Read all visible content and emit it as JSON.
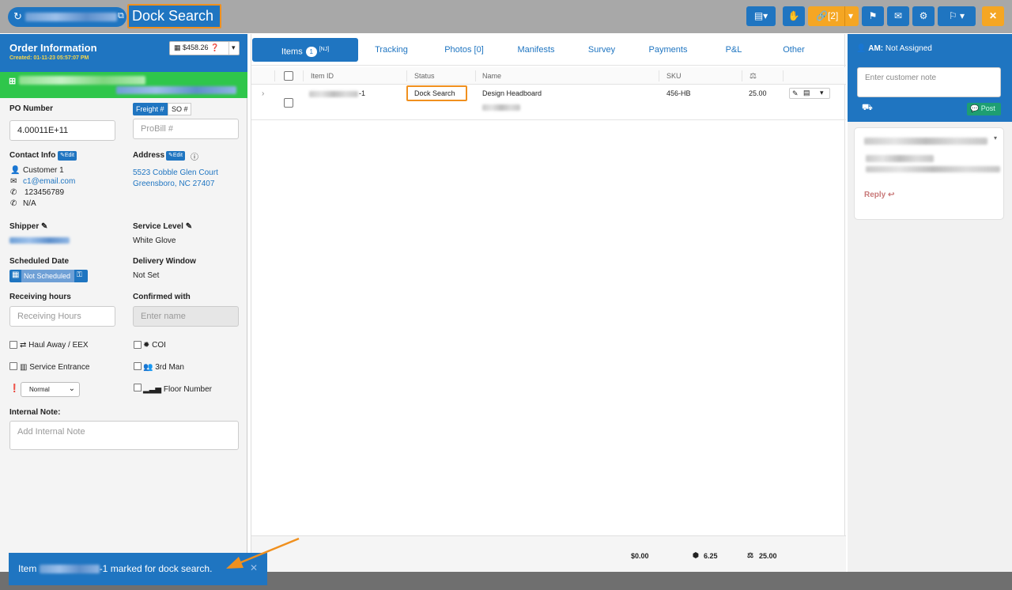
{
  "header": {
    "title": "Dock Search",
    "buttons": {
      "links_count": "[2]"
    }
  },
  "order_info": {
    "title": "Order Information",
    "created": "Created: 01-11-23 05:57:07 PM",
    "price": "$458.26",
    "po_label": "PO Number",
    "po_value": "4.00011E+11",
    "freight_tab": "Freight #",
    "so_tab": "SO #",
    "probill_placeholder": "ProBill #",
    "contact_label": "Contact Info",
    "edit_label": "Edit",
    "address_label": "Address",
    "contact_name": "Customer 1",
    "contact_email": "c1@email.com",
    "contact_phone": "123456789",
    "contact_phone2": "N/A",
    "address_line1": "5523 Cobble Glen Court",
    "address_line2": "Greensboro, NC 27407",
    "shipper_label": "Shipper",
    "service_level_label": "Service Level",
    "service_level_value": "White Glove",
    "scheduled_label": "Scheduled Date",
    "scheduled_value": "Not Scheduled",
    "delivery_window_label": "Delivery Window",
    "delivery_window_value": "Not Set",
    "receiving_label": "Receiving hours",
    "receiving_placeholder": "Receiving Hours",
    "confirmed_label": "Confirmed with",
    "confirmed_placeholder": "Enter name",
    "haul_away": "Haul Away / EEX",
    "coi": "COI",
    "service_entrance": "Service Entrance",
    "third_man": "3rd Man",
    "priority_value": "Normal",
    "floor_number": "Floor Number",
    "internal_note_label": "Internal Note:",
    "internal_note_placeholder": "Add Internal Note"
  },
  "tabs": [
    {
      "label": "Items",
      "count": "1",
      "sup": "[NJ]"
    },
    {
      "label": "Tracking"
    },
    {
      "label": "Photos [0]"
    },
    {
      "label": "Manifests"
    },
    {
      "label": "Survey"
    },
    {
      "label": "Payments"
    },
    {
      "label": "P&L"
    },
    {
      "label": "Other"
    }
  ],
  "table": {
    "columns": [
      "Item ID",
      "Status",
      "Name",
      "SKU"
    ],
    "row": {
      "item_id_suffix": "-1",
      "status": "Dock Search",
      "name": "Design Headboard",
      "sku": "456-HB",
      "weight": "25.00"
    }
  },
  "totals": {
    "price": "$0.00",
    "cube": "6.25",
    "weight": "25.00"
  },
  "right_panel": {
    "am_label": "AM:",
    "am_value": "Not Assigned",
    "note_placeholder": "Enter customer note",
    "post_label": "Post",
    "reply_label": "Reply"
  },
  "toast": {
    "prefix": "Item",
    "suffix": "-1 marked for dock search."
  },
  "colors": {
    "primary": "#1f75c1",
    "orange": "#f5a623",
    "highlight": "#f0901e",
    "green": "#2fc64b"
  }
}
